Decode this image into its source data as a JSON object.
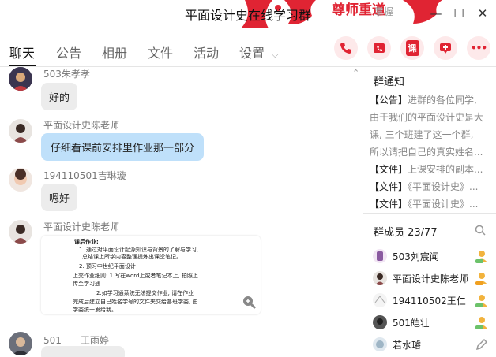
{
  "window": {
    "title": "平面设计史在线学习群",
    "corner_banner": "尊师重道",
    "corner_grey": "掌握",
    "controls": {
      "minimize": "—",
      "maximize": "☐",
      "close": "✕"
    }
  },
  "tabs": [
    {
      "label": "聊天"
    },
    {
      "label": "公告"
    },
    {
      "label": "相册"
    },
    {
      "label": "文件"
    },
    {
      "label": "活动"
    },
    {
      "label": "设置"
    }
  ],
  "toolbar": {
    "phone_icon": "phone-icon",
    "video_icon": "video-call-icon",
    "class_label": "课",
    "screen_icon": "screen-share-icon",
    "more_label": "•••"
  },
  "messages": [
    {
      "sender": "503朱孝孝",
      "text": "好的",
      "style": "grey"
    },
    {
      "sender": "平面设计史陈老师",
      "text": "仔细看课前安排里作业那一部分",
      "style": "blue"
    },
    {
      "sender": "194110501吉琳璇",
      "text": "嗯好",
      "style": "grey"
    },
    {
      "sender": "平面设计史陈老师",
      "style": "image",
      "image_lines": [
        "课后作业:",
        "1. 通过对平面设计起源知识与背景的了解与学习,",
        "总结课上所学内容整理提炼出课堂笔记。",
        "2. 预习中世纪平面设计",
        "上交作业细则: 1.写在word上或者笔记本上, 拍照上",
        "传至学习通",
        "2.如学习通系统无法提交作业, 请在作业",
        "完成后建立自己姓名学号的文件夹交给各班学委, 由",
        "学委统一发给我。"
      ]
    },
    {
      "sender": "501　　王雨婷",
      "text": "",
      "style": "grey"
    }
  ],
  "notice": {
    "heading": "群通知",
    "tag": "【公告】",
    "lines": [
      "进群的各位同学,",
      "由于我们的平面设计史是大",
      "课, 三个班建了这一个群,",
      "所以请把自己的真实姓名..."
    ]
  },
  "files": [
    {
      "tag": "【文件】",
      "name": "上课安排的副本..."
    },
    {
      "tag": "【文件】",
      "name": "《平面设计史》..."
    },
    {
      "tag": "【文件】",
      "name": "《平面设计史》..."
    }
  ],
  "members": {
    "heading": "群成员 23/77",
    "list": [
      {
        "name": "503刘宸闻"
      },
      {
        "name": "平面设计史陈老师"
      },
      {
        "name": "194110502王仁"
      },
      {
        "name": "501皑壮"
      },
      {
        "name": "若水璿"
      }
    ]
  },
  "colors": {
    "accent": "#e02433",
    "bubble_blue": "#bfe0fa",
    "bubble_grey": "#ececec"
  }
}
